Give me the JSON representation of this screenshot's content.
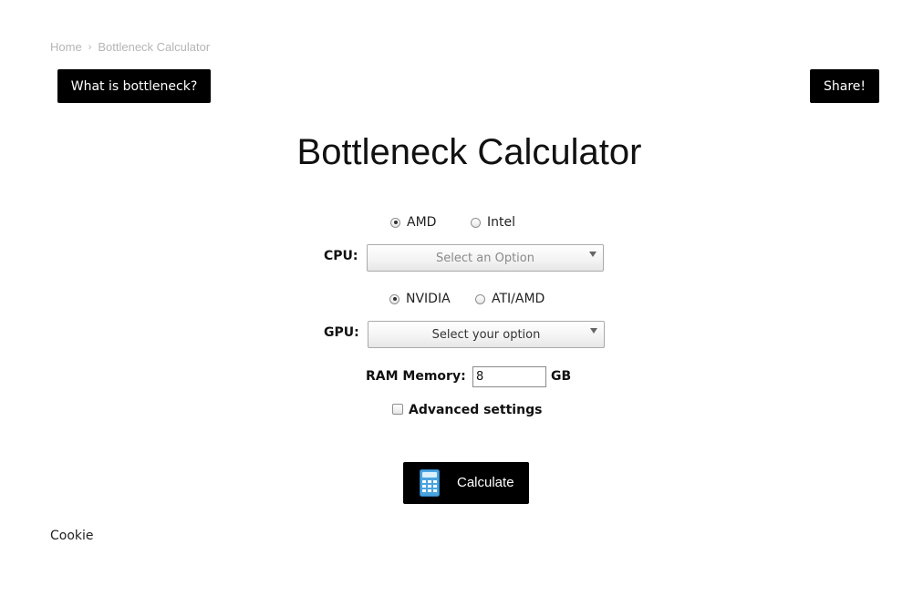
{
  "breadcrumb": {
    "home": "Home",
    "separator": "›",
    "current": "Bottleneck Calculator"
  },
  "header": {
    "what_button": "What is bottleneck?",
    "share_button": "Share!"
  },
  "main": {
    "title": "Bottleneck Calculator"
  },
  "cpu": {
    "brand_options": [
      {
        "label": "AMD",
        "checked": true
      },
      {
        "label": "Intel",
        "checked": false
      }
    ],
    "label": "CPU:",
    "select_value": "Select an Option"
  },
  "gpu": {
    "brand_options": [
      {
        "label": "NVIDIA",
        "checked": true
      },
      {
        "label": "ATI/AMD",
        "checked": false
      }
    ],
    "label": "GPU:",
    "select_value": "Select your option"
  },
  "ram": {
    "label": "RAM Memory:",
    "value": "8",
    "unit": "GB"
  },
  "advanced": {
    "label": "Advanced settings",
    "checked": false
  },
  "calculate": {
    "label": "Calculate",
    "icon": "calculator-icon"
  },
  "footer": {
    "cookie": "Cookie"
  },
  "colors": {
    "button_bg": "#000000",
    "button_text": "#ffffff",
    "breadcrumb_text": "#b5b5b5",
    "calculator_icon": "#4aa3df"
  }
}
